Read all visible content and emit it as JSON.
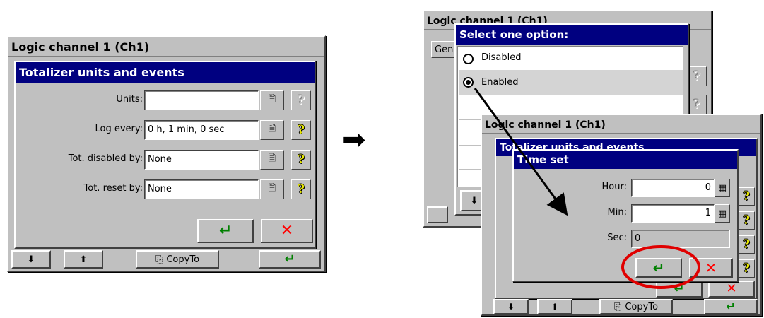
{
  "left_window": {
    "title": "Logic channel 1 (Ch1)",
    "dialog_title": "Totalizer units and events",
    "rows": [
      {
        "label": "Units:",
        "value": ""
      },
      {
        "label": "Log every:",
        "value": "0 h, 1 min, 0 sec"
      },
      {
        "label": "Tot. disabled by:",
        "value": "None"
      },
      {
        "label": "Tot. reset by:",
        "value": "None"
      }
    ],
    "ok_symbol": "↵",
    "cancel_symbol": "✕",
    "bottom_bar": {
      "down_icon": "⬇",
      "up_icon": "⬆",
      "copyto_icon": "⎘",
      "copyto_label": "CopyTo",
      "ok_symbol": "↵"
    }
  },
  "arrow_symbol": "➡",
  "right_back_window": {
    "title": "Logic channel 1 (Ch1)",
    "tab_partial": "Gen"
  },
  "option_popup": {
    "title": "Select one option:",
    "options": [
      {
        "label": "Disabled",
        "selected": false
      },
      {
        "label": "Enabled",
        "selected": true
      }
    ],
    "down_icon": "⬇"
  },
  "right_front_window": {
    "title": "Logic channel 1 (Ch1)",
    "dialog_title": "Totalizer units and events",
    "bottom_bar": {
      "copyto_icon": "⎘",
      "copyto_label": "CopyTo",
      "ok_symbol": "↵"
    }
  },
  "time_set": {
    "title": "Time set",
    "fields": [
      {
        "label": "Hour:",
        "value": "0"
      },
      {
        "label": "Min:",
        "value": "1"
      },
      {
        "label": "Sec:",
        "value": "0"
      }
    ],
    "ok_symbol": "↵",
    "cancel_symbol": "✕"
  },
  "colors": {
    "title_blue": "#000080",
    "dialog_gray": "#c0c0c0",
    "highlight_circle": "#e00000",
    "ok_green": "#008000",
    "cancel_red": "#ff0000"
  }
}
